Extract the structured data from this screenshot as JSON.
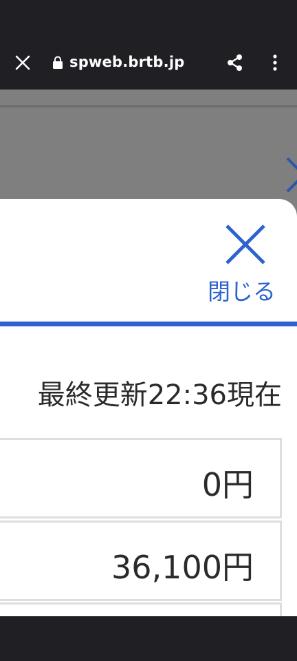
{
  "browser": {
    "url": "spweb.brtb.jp",
    "icons": {
      "close": "close-icon",
      "lock": "lock-icon",
      "share": "share-icon",
      "more": "more-vert-icon"
    }
  },
  "panel": {
    "close_label": "閉じる",
    "updated_text": "最終更新22:36現在",
    "rows": [
      {
        "value": "0円"
      },
      {
        "value": "36,100円"
      },
      {
        "value": ""
      }
    ]
  },
  "colors": {
    "accent": "#2d62cf",
    "chrome": "#1f1f24",
    "overlay": "#7f7f7f",
    "text": "#2a2a2a",
    "row_border": "#dedede"
  }
}
